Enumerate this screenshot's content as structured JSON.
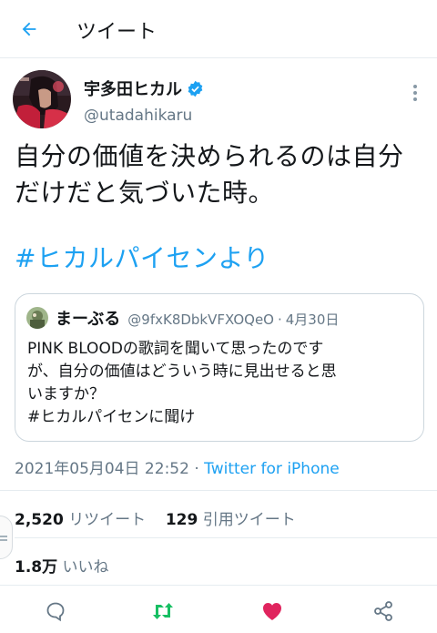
{
  "header": {
    "title": "ツイート"
  },
  "author": {
    "display_name": "宇多田ヒカル",
    "handle": "@utadahikaru"
  },
  "tweet": {
    "line1": "自分の価値を決められるのは自分",
    "line2": "だけだと気づいた時。",
    "hashtag": "#ヒカルパイセンより"
  },
  "quote": {
    "name": "まーぶる",
    "handle": "@9fxK8DbkVFXOQeO",
    "separator": "·",
    "date": "4月30日",
    "line1": "PINK BLOODの歌詞を聞いて思ったのです",
    "line2": "が、自分の価値はどういう時に見出せると思",
    "line3": "いますか？",
    "line4": "#ヒカルパイセンに聞け"
  },
  "meta": {
    "timestamp": "2021年05月04日 22:52",
    "separator": " · ",
    "source": "Twitter for iPhone"
  },
  "stats": {
    "retweets_count": "2,520",
    "retweets_label": "リツイート",
    "quotes_count": "129",
    "quotes_label": "引用ツイート",
    "likes_count": "1.8万",
    "likes_label": "いいね"
  },
  "colors": {
    "accent": "#1da1f2",
    "retweet": "#17bf63",
    "like": "#e0245e",
    "secondary": "#657786"
  },
  "icons": [
    "back-arrow-icon",
    "verified-badge-icon",
    "more-icon",
    "reply-icon",
    "retweet-icon",
    "like-icon",
    "share-icon"
  ]
}
